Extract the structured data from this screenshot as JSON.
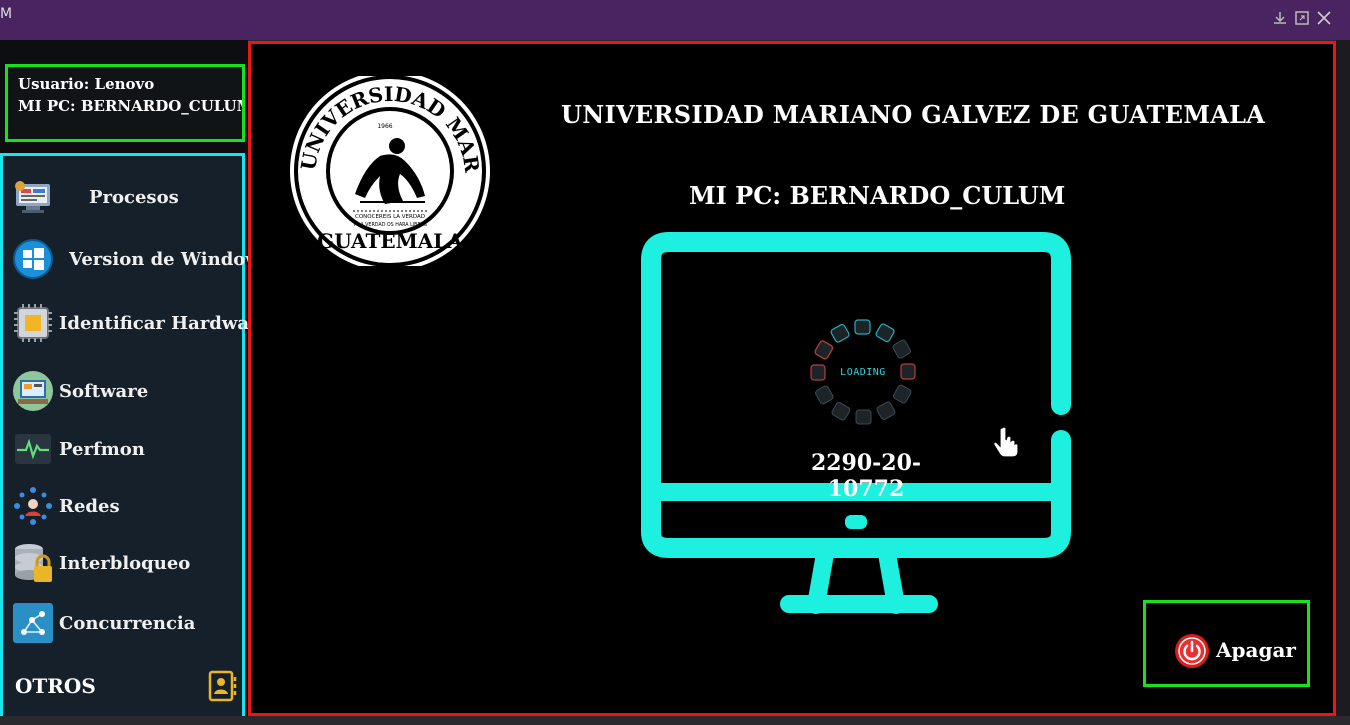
{
  "window": {
    "title_fragment": "M",
    "controls": [
      "download-icon",
      "restore-icon",
      "close-icon"
    ]
  },
  "user_panel": {
    "usuario": "Usuario: Lenovo",
    "pc": "MI PC:  BERNARDO_CULUM"
  },
  "menu": {
    "items": [
      {
        "label": "Procesos",
        "icon": "processes-icon"
      },
      {
        "label": "Version de Windows",
        "icon": "windows-icon"
      },
      {
        "label": "Identificar Hardware",
        "icon": "chip-icon"
      },
      {
        "label": "Software",
        "icon": "software-icon"
      },
      {
        "label": "Perfmon",
        "icon": "perfmon-icon"
      },
      {
        "label": "Redes",
        "icon": "network-icon"
      },
      {
        "label": "Interbloqueo",
        "icon": "database-lock-icon"
      },
      {
        "label": "Concurrencia",
        "icon": "concurrency-icon"
      }
    ],
    "otros": "OTROS"
  },
  "main": {
    "university": "UNIVERSIDAD MARIANO GALVEZ DE GUATEMALA",
    "pc_title": "MI PC: BERNARDO_CULUM",
    "loading": "LOADING",
    "code": "2290-20-10772",
    "seal_text": "UNIVERSIDAD MARIANO GALVEZ GUATEMALA",
    "seal_year": "1966",
    "seal_motto": "CONOCEREIS LA VERDAD Y LA VERDAD OS HARA LIBRES"
  },
  "actions": {
    "apagar": "Apagar"
  },
  "colors": {
    "titlebar": "#4a2461",
    "accent_green": "#17e21c",
    "accent_cyan": "#18e6ef",
    "accent_red": "#f01414",
    "monitor": "#1ef0df"
  }
}
